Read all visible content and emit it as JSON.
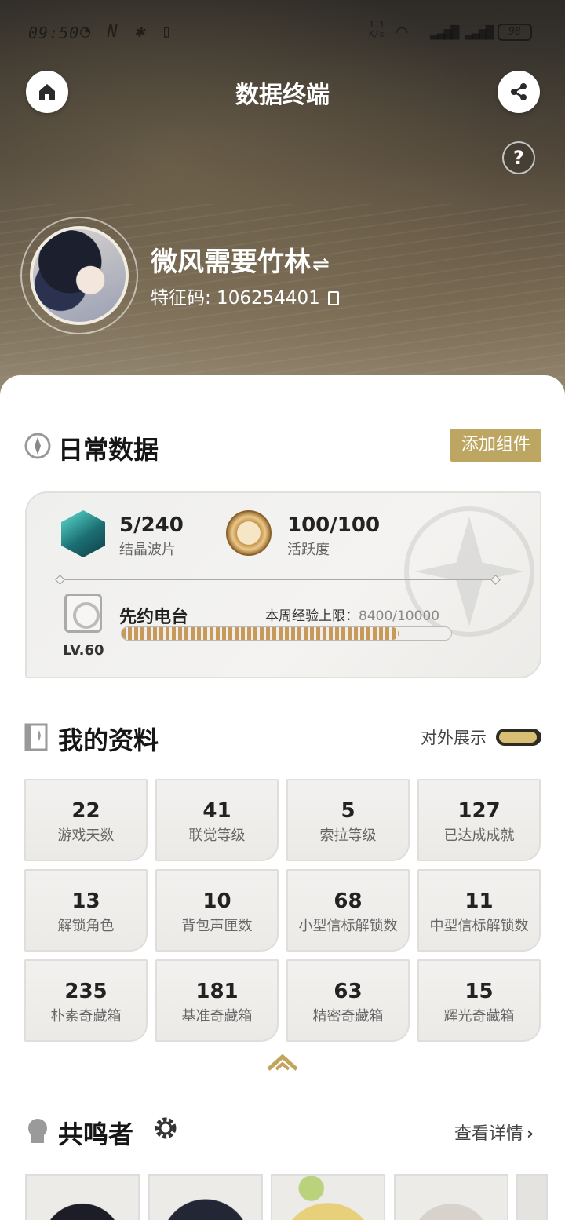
{
  "status_bar": {
    "time": "09:50",
    "net_speed": "1.1\nK/s",
    "battery": "98"
  },
  "header": {
    "title": "数据终端",
    "home_icon": "home-icon",
    "share_icon": "share-icon",
    "help_label": "?"
  },
  "profile": {
    "nickname": "微风需要竹林",
    "uid_label": "特征码: 106254401"
  },
  "daily": {
    "title": "日常数据",
    "add_widget_label": "添加组件",
    "crystal_value": "5/240",
    "crystal_label": "结晶波片",
    "activity_value": "100/100",
    "activity_label": "活跃度",
    "radio_title": "先约电台",
    "radio_level": "LV.60",
    "exp_limit_label": "本周经验上限：",
    "exp_limit_value": "8400/10000",
    "exp_progress": 0.84
  },
  "my_profile": {
    "title": "我的资料",
    "toggle_label": "对外展示",
    "toggle_on": true,
    "stats": [
      {
        "value": "22",
        "label": "游戏天数"
      },
      {
        "value": "41",
        "label": "联觉等级"
      },
      {
        "value": "5",
        "label": "索拉等级"
      },
      {
        "value": "127",
        "label": "已达成成就"
      },
      {
        "value": "13",
        "label": "解锁角色"
      },
      {
        "value": "10",
        "label": "背包声匣数"
      },
      {
        "value": "68",
        "label": "小型信标解锁数"
      },
      {
        "value": "11",
        "label": "中型信标解锁数"
      },
      {
        "value": "235",
        "label": "朴素奇藏箱"
      },
      {
        "value": "181",
        "label": "基准奇藏箱"
      },
      {
        "value": "63",
        "label": "精密奇藏箱"
      },
      {
        "value": "15",
        "label": "辉光奇藏箱"
      }
    ]
  },
  "resonators": {
    "title": "共鸣者",
    "detail_label": "查看详情"
  },
  "colors": {
    "accent_gold": "#bda662",
    "toggle_on": "#d8bf73",
    "exp_fill": "#c79a5a"
  }
}
